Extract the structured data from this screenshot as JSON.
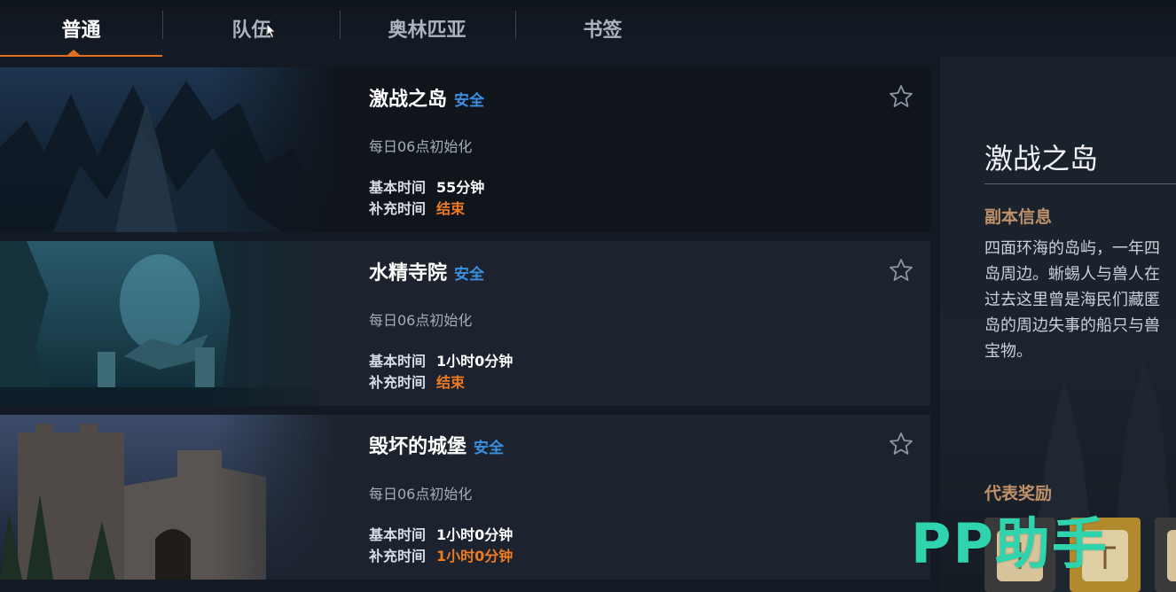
{
  "tabs": [
    {
      "label": "普通",
      "active": true
    },
    {
      "label": "队伍",
      "active": false
    },
    {
      "label": "奥林匹亚",
      "active": false
    },
    {
      "label": "书签",
      "active": false
    }
  ],
  "dungeons": [
    {
      "name": "激战之岛",
      "status": "安全",
      "reset": "每日06点初始化",
      "base_label": "基本时间",
      "base_value": "55分钟",
      "extra_label": "补充时间",
      "extra_value": "结束",
      "selected": true
    },
    {
      "name": "水精寺院",
      "status": "安全",
      "reset": "每日06点初始化",
      "base_label": "基本时间",
      "base_value": "1小时0分钟",
      "extra_label": "补充时间",
      "extra_value": "结束",
      "selected": false
    },
    {
      "name": "毁坏的城堡",
      "status": "安全",
      "reset": "每日06点初始化",
      "base_label": "基本时间",
      "base_value": "1小时0分钟",
      "extra_label": "补充时间",
      "extra_value": "1小时0分钟",
      "selected": false
    }
  ],
  "detail": {
    "title": "激战之岛",
    "info_heading": "副本信息",
    "description_lines": [
      "四面环海的岛屿，一年四",
      "岛周边。蜥蜴人与兽人在",
      "过去这里曾是海民们藏匿",
      "岛的周边失事的船只与兽",
      "宝物。"
    ],
    "reward_heading": "代表奖励"
  },
  "watermark": "PP助手",
  "colors": {
    "accent_orange": "#ef7b22",
    "status_blue": "#3a8fe0",
    "section_heading": "#c0926a"
  }
}
